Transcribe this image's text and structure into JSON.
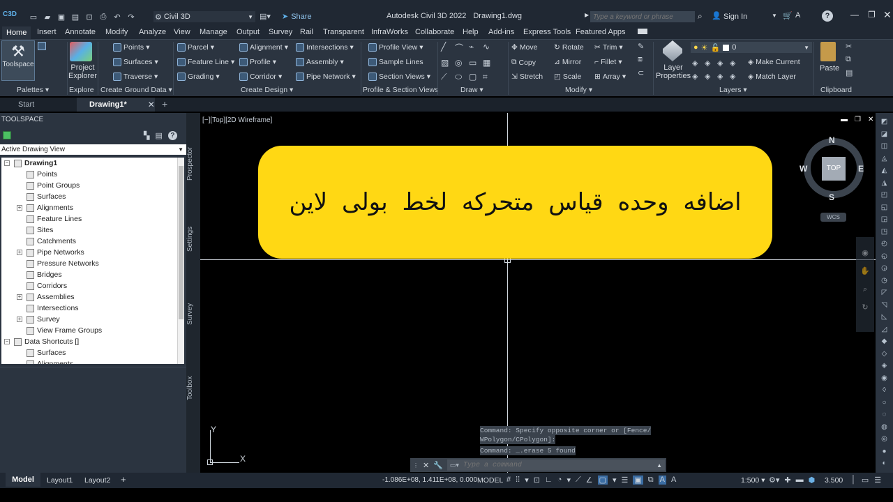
{
  "app": {
    "title": "Autodesk Civil 3D 2022",
    "document": "Drawing1.dwg",
    "logo": "C3D",
    "workspace": "Civil 3D",
    "share": "Share",
    "search_placeholder": "Type a keyword or phrase",
    "sign_in": "Sign In"
  },
  "tabs": [
    "Home",
    "Insert",
    "Annotate",
    "Modify",
    "Analyze",
    "View",
    "Manage",
    "Output",
    "Survey",
    "Rail",
    "Transparent",
    "InfraWorks",
    "Collaborate",
    "Help",
    "Add-ins",
    "Express Tools",
    "Featured Apps"
  ],
  "ribbon": {
    "toolspace": "Toolspace",
    "project_explorer": [
      "Project",
      "Explorer"
    ],
    "points": "Points",
    "surfaces": "Surfaces",
    "traverse": "Traverse",
    "parcel": "Parcel",
    "feature_line": "Feature Line",
    "grading": "Grading",
    "alignment": "Alignment",
    "profile": "Profile",
    "corridor": "Corridor",
    "intersections": "Intersections",
    "assembly": "Assembly",
    "pipe_network": "Pipe Network",
    "profile_view": "Profile View",
    "sample_lines": "Sample Lines",
    "section_views": "Section Views",
    "move": "Move",
    "rotate": "Rotate",
    "trim": "Trim",
    "copy": "Copy",
    "mirror": "Mirror",
    "fillet": "Fillet",
    "stretch": "Stretch",
    "scale": "Scale",
    "array": "Array",
    "layer_properties": [
      "Layer",
      "Properties"
    ],
    "layer_value": "0",
    "make_current": "Make Current",
    "match_layer": "Match Layer",
    "paste": "Paste",
    "panels": [
      "Palettes",
      "Explore",
      "Create Ground Data",
      "Create Design",
      "Profile & Section Views",
      "Draw",
      "Modify",
      "Layers",
      "Clipboard"
    ]
  },
  "doc_tabs": {
    "start": "Start",
    "active": "Drawing1*"
  },
  "toolspace": {
    "title": "TOOLSPACE",
    "view_select": "Active Drawing View",
    "root": "Drawing1",
    "items": [
      "Points",
      "Point Groups",
      "Surfaces",
      "Alignments",
      "Feature Lines",
      "Sites",
      "Catchments",
      "Pipe Networks",
      "Pressure Networks",
      "Bridges",
      "Corridors",
      "Assemblies",
      "Intersections",
      "Survey",
      "View Frame Groups"
    ],
    "data_shortcuts": "Data Shortcuts []",
    "shortcut_items": [
      "Surfaces",
      "Alignments"
    ]
  },
  "vertical_tabs": [
    "Prospector",
    "Settings",
    "Survey",
    "Toolbox"
  ],
  "viewport": {
    "label": "[−][Top][2D Wireframe]",
    "banner_text": "اضافه وحده قیاس متحرکه لخط بولی لاین",
    "banner_color": "#ffd814",
    "viewcube": {
      "n": "N",
      "s": "S",
      "e": "E",
      "w": "W",
      "top": "TOP",
      "wcs": "WCS"
    },
    "ucs": {
      "x": "X",
      "y": "Y"
    }
  },
  "command": {
    "history": [
      "Command: Specify opposite corner or [Fence/",
      "WPolygon/CPolygon]:",
      "Command: _.erase 5 found"
    ],
    "placeholder": "Type a command"
  },
  "layout_tabs": [
    "Model",
    "Layout1",
    "Layout2"
  ],
  "status": {
    "coords": "-1.086E+08, 1.411E+08, 0.000",
    "model": "MODEL",
    "scale": "1:500",
    "elevation": "3.500"
  }
}
